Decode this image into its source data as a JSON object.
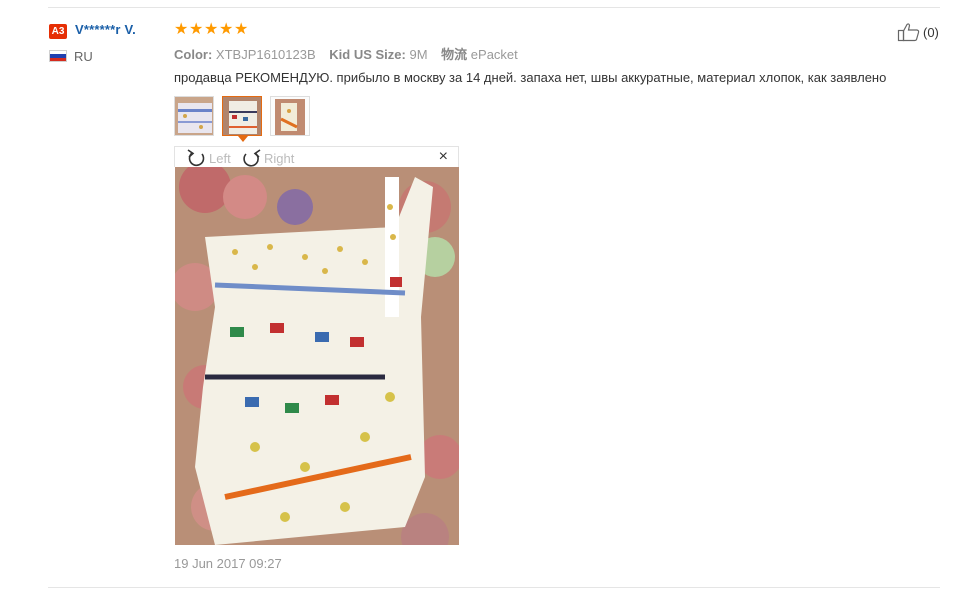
{
  "reviewer": {
    "level_badge": "A3",
    "name": "V******r V.",
    "country_code": "RU",
    "flag_colors": [
      "#ffffff",
      "#2040b0",
      "#d52b1e"
    ]
  },
  "review": {
    "rating": 5,
    "star_color": "#ff9a00",
    "properties": [
      {
        "label": "Color:",
        "value": "XTBJP1610123B"
      },
      {
        "label": "Kid US Size:",
        "value": "9M"
      },
      {
        "label": "物流",
        "value": "ePacket"
      }
    ],
    "text": "продавца РЕКОМЕНДУЮ. прибыло в москву за 14 дней. запаха нет, швы аккуратные, материал хлопок, как заявлено",
    "date": "19 Jun 2017 09:27"
  },
  "viewer": {
    "rotate_left_label": "Left",
    "rotate_right_label": "Right",
    "close_label": "×",
    "selected_thumbnail": 2
  },
  "helpful": {
    "count_label": "(0)"
  }
}
